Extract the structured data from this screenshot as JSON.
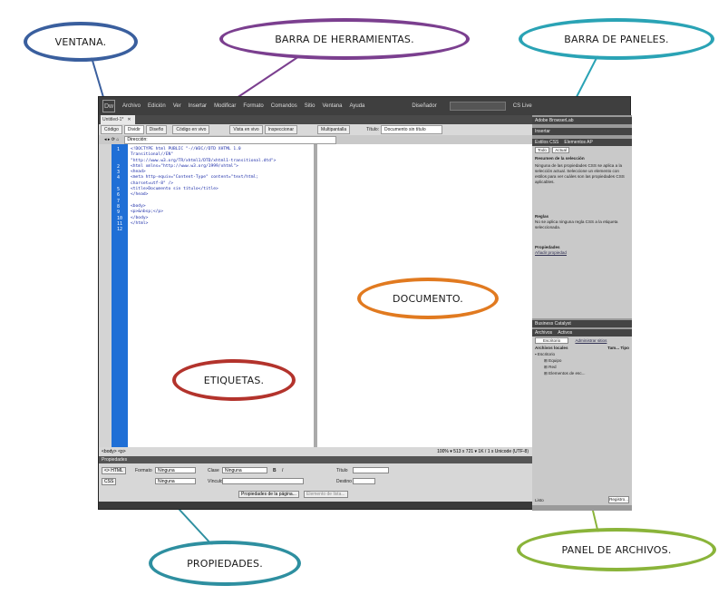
{
  "callouts": {
    "ventana": "VENTANA.",
    "barra_herramientas": "BARRA DE HERRAMIENTAS.",
    "barra_paneles": "BARRA DE PANELES.",
    "documento": "DOCUMENTO.",
    "etiquetas": "ETIQUETAS.",
    "propiedades": "PROPIEDADES.",
    "panel_archivos": "PANEL DE ARCHIVOS."
  },
  "colors": {
    "ventana": "#3a5f9e",
    "barra_herramientas": "#7b3f8f",
    "barra_paneles": "#2aa3b5",
    "documento": "#e17a20",
    "etiquetas": "#b3332c",
    "propiedades": "#2e8fa0",
    "panel_archivos": "#8ab43a"
  },
  "app": {
    "logo": "Dw",
    "menu": [
      "Archivo",
      "Edición",
      "Ver",
      "Insertar",
      "Modificar",
      "Formato",
      "Comandos",
      "Sitio",
      "Ventana",
      "Ayuda"
    ],
    "workspace": "Diseñador",
    "cslive": "CS Live",
    "doc_tab": "Untitled-1*",
    "toolbar": {
      "codigo": "Código",
      "dividir": "Dividir",
      "diseno": "Diseño",
      "codigo_vivo": "Código en vivo",
      "vista_vivo": "Vista en vivo",
      "inspeccionar": "Inspeccionar",
      "multipantalla": "Multipantalla",
      "titulo_label": "Título:",
      "titulo_value": "Documento sin título"
    },
    "address_label": "Dirección:",
    "line_numbers": [
      "1",
      "2",
      "3",
      "4",
      "5",
      "6",
      "7",
      "8",
      "9",
      "10",
      "11",
      "12"
    ],
    "code": "<!DOCTYPE html PUBLIC \"-//W3C//DTD XHTML 1.0\nTransitional//EN\"\n\"http://www.w3.org/TR/xhtml1/DTD/xhtml1-transitional.dtd\">\n<html xmlns=\"http://www.w3.org/1999/xhtml\">\n<head>\n<meta http-equiv=\"Content-Type\" content=\"text/html;\ncharset=utf-8\" />\n<title>Documento sin título</title>\n</head>\n\n<body>\n<p>&nbsp;</p>\n</body>\n</html>",
    "tag_selector": "<body> <p>",
    "status_right": "100%  ▾  513 x 721 ▾  1K / 1 s  Unicode (UTF-8)",
    "properties": {
      "header": "Propiedades",
      "html_btn": "<> HTML",
      "css_btn": "CSS",
      "formato_label": "Formato",
      "formato_value": "Ninguna",
      "clase_label": "Clase",
      "clase_value": "Ninguna",
      "titulo_label": "Título",
      "id_value": "Ninguna",
      "vinculo_label": "Vínculo",
      "destino_label": "Destino",
      "page_props": "Propiedades de la página...",
      "list_item": "Elemento de lista..."
    },
    "panels": {
      "adobe_browserlab": "Adobe BrowserLab",
      "insertar": "Insertar",
      "css_tab": "Estilos CSS",
      "ap_tab": "Elementos AP",
      "todo": "Todo",
      "actual": "Actual",
      "resumen_title": "Resumen de la selección",
      "resumen_text": "Ninguna de las propiedades CSS se aplica a la selección actual. Seleccione un elemento con estilos para ver cuáles son las propiedades CSS aplicables.",
      "reglas_title": "Reglas",
      "reglas_text": "No se aplica ninguna regla CSS a la etiqueta seleccionada.",
      "propiedades_title": "Propiedades",
      "anadir": "Añadir propiedad",
      "business": "Business Catalyst",
      "archivos_tab": "Archivos",
      "activos_tab": "Activos",
      "site": "Escritorio",
      "admin": "Administrar sitios",
      "locales": "Archivos locales",
      "tam": "Tam...",
      "tipo": "Tipo",
      "tree": [
        "Escritorio",
        "Equipo",
        "Red",
        "Elementos de esc..."
      ],
      "listo": "Listo",
      "registro": "Registro..."
    }
  }
}
